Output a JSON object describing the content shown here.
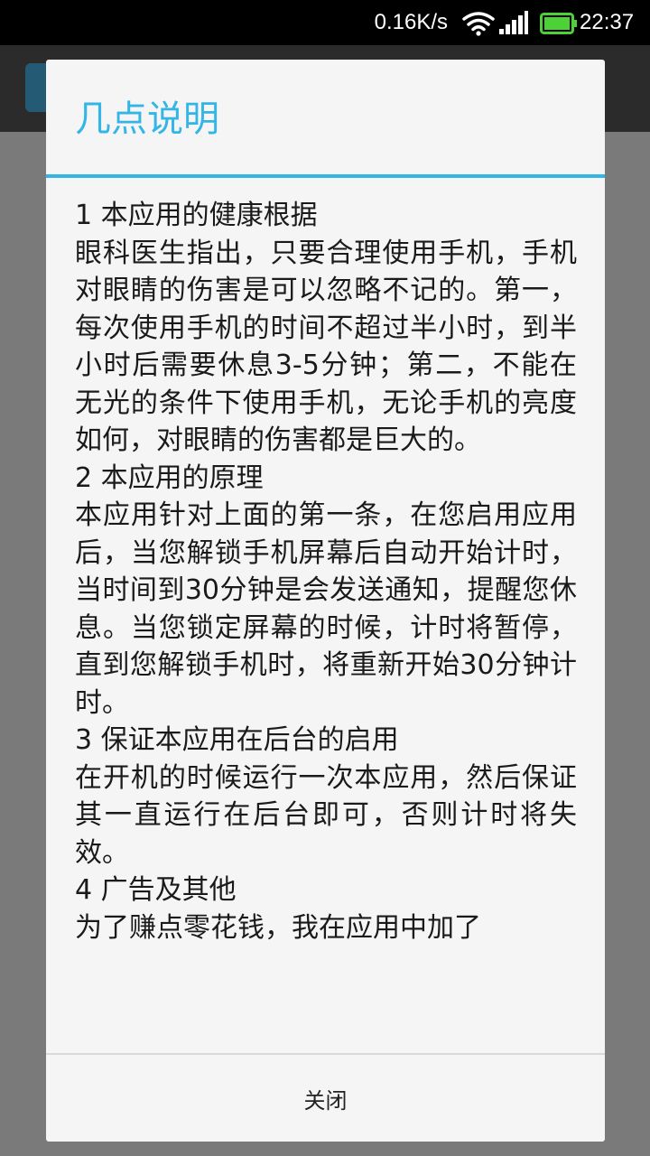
{
  "status_bar": {
    "network_speed": "0.16K/s",
    "time": "22:37",
    "icons": [
      "wifi-icon",
      "signal-icon",
      "battery-icon"
    ]
  },
  "colors": {
    "accent": "#33b5e5",
    "battery": "#4cd137"
  },
  "dialog": {
    "title": "几点说明",
    "paragraphs": [
      "1 本应用的健康根据",
      "眼科医生指出，只要合理使用手机，手机对眼睛的伤害是可以忽略不记的。第一，每次使用手机的时间不超过半小时，到半小时后需要休息3-5分钟；第二，不能在无光的条件下使用手机，无论手机的亮度如何，对眼睛的伤害都是巨大的。",
      "2 本应用的原理",
      "本应用针对上面的第一条，在您启用应用后，当您解锁手机屏幕后自动开始计时，当时间到30分钟是会发送通知，提醒您休息。当您锁定屏幕的时候，计时将暂停，直到您解锁手机时，将重新开始30分钟计时。",
      "3 保证本应用在后台的启用",
      "在开机的时候运行一次本应用，然后保证其一直运行在后台即可，否则计时将失效。",
      "4 广告及其他",
      "为了赚点零花钱，我在应用中加了"
    ],
    "close_label": "关闭"
  }
}
